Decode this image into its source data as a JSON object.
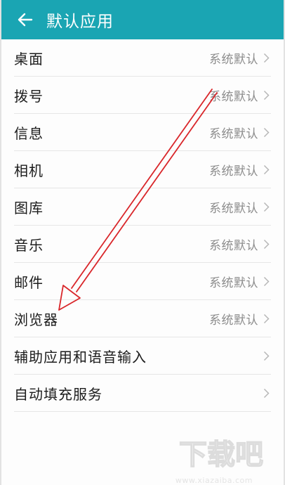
{
  "colors": {
    "appbar": "#1aa5b3",
    "annotation_arrow": "#d9262a"
  },
  "appbar": {
    "title": "默认应用",
    "back_icon": "arrow-left-icon"
  },
  "items": [
    {
      "title": "桌面",
      "value": "系统默认"
    },
    {
      "title": "拨号",
      "value": "系统默认"
    },
    {
      "title": "信息",
      "value": "系统默认"
    },
    {
      "title": "相机",
      "value": "系统默认"
    },
    {
      "title": "图库",
      "value": "系统默认"
    },
    {
      "title": "音乐",
      "value": "系统默认"
    },
    {
      "title": "邮件",
      "value": "系统默认"
    },
    {
      "title": "浏览器",
      "value": "系统默认"
    },
    {
      "title": "辅助应用和语音输入",
      "value": ""
    },
    {
      "title": "自动填充服务",
      "value": ""
    }
  ],
  "watermark": {
    "logo_text": "下载吧",
    "url": "www.xiazaiba.com"
  }
}
